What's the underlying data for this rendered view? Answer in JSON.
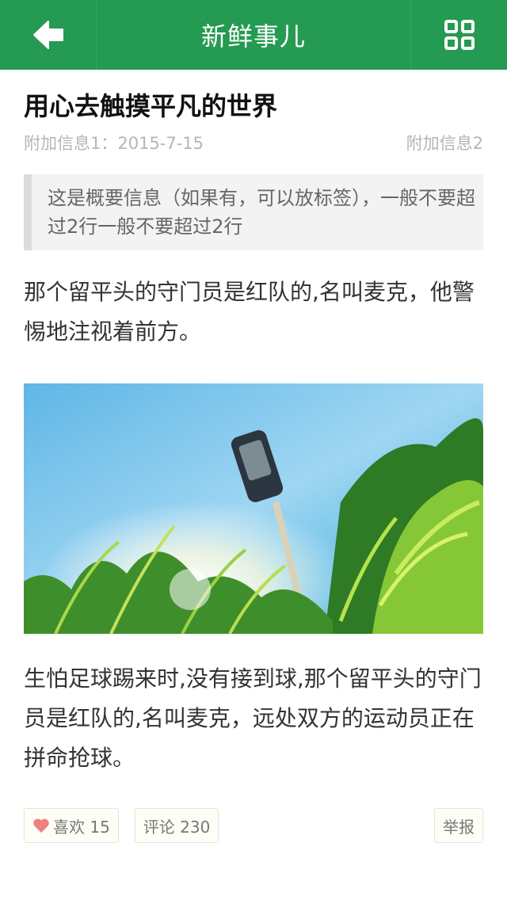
{
  "header": {
    "title": "新鲜事儿",
    "back_icon": "arrow-left-icon",
    "menu_icon": "grid-icon",
    "background": "#259a52"
  },
  "article": {
    "title": "用心去触摸平凡的世界",
    "meta_left": "附加信息1：2015-7-15",
    "meta_right": "附加信息2",
    "summary": "这是概要信息（如果有，可以放标签），一般不要超过2行一般不要超过2行",
    "paragraph1": "那个留平头的守门员是红队的,名叫麦克，他警惕地注视着前方。",
    "paragraph2": "生怕足球踢来时,没有接到球,那个留平头的守门员是红队的,名叫麦克，远处双方的运动员正在拼命抢球。"
  },
  "actions": {
    "like_label": "喜欢 15",
    "comment_label": "评论 230",
    "report_label": "举报",
    "heart_color": "#f07f7f"
  }
}
